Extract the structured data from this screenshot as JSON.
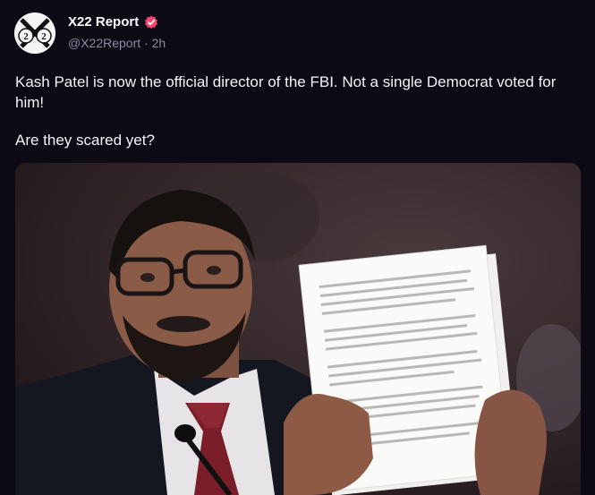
{
  "post": {
    "author": {
      "name": "X22 Report",
      "handle": "@X22Report",
      "separator": "·",
      "time": "2h",
      "avatar_text": "X22",
      "verified_icon": "verified-badge-icon",
      "verified_color": "#f0466e"
    },
    "text": {
      "line1": "Kash Patel is now the official director of the FBI. Not a single Democrat voted for him!",
      "line2": "Are they scared yet?"
    },
    "media": {
      "type": "photo",
      "subject": "man in suit holding up papers at hearing"
    }
  },
  "colors": {
    "background": "#0c0a14",
    "text": "#f4f3f7",
    "muted": "#8e8aa0",
    "accent": "#f0466e"
  }
}
